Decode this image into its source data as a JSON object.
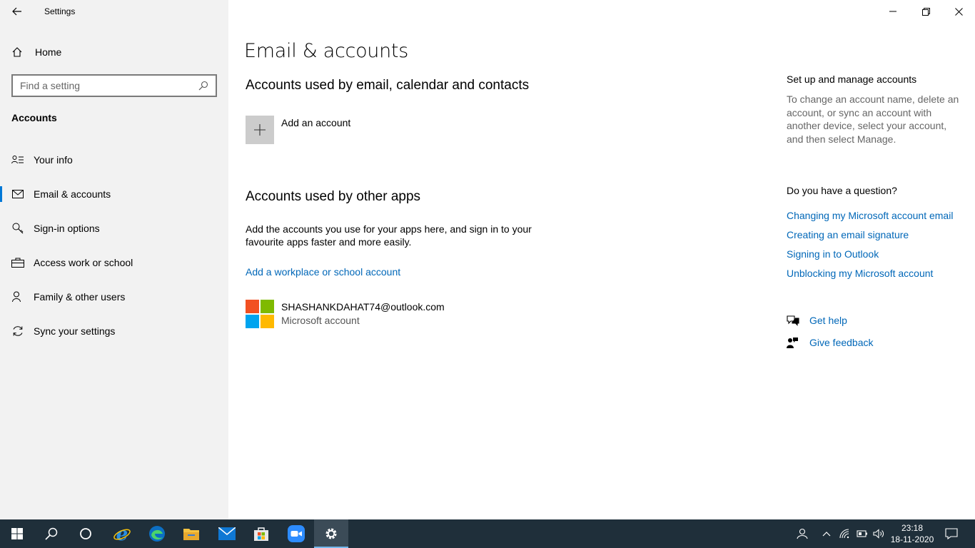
{
  "window": {
    "title": "Settings"
  },
  "sidebar": {
    "home_label": "Home",
    "search_placeholder": "Find a setting",
    "section": "Accounts",
    "items": [
      {
        "label": "Your info",
        "icon": "person-card-icon"
      },
      {
        "label": "Email & accounts",
        "icon": "mail-icon",
        "active": true
      },
      {
        "label": "Sign-in options",
        "icon": "key-icon"
      },
      {
        "label": "Access work or school",
        "icon": "briefcase-icon"
      },
      {
        "label": "Family & other users",
        "icon": "person-add-icon"
      },
      {
        "label": "Sync your settings",
        "icon": "sync-icon"
      }
    ]
  },
  "main": {
    "title": "Email & accounts",
    "section1": {
      "heading": "Accounts used by email, calendar and contacts",
      "add_account": "Add an account"
    },
    "section2": {
      "heading": "Accounts used by other apps",
      "description": "Add the accounts you use for your apps here, and sign in to your favourite apps faster and more easily.",
      "add_workplace": "Add a workplace or school account",
      "account": {
        "email": "SHASHANKDAHAT74@outlook.com",
        "type": "Microsoft account"
      }
    }
  },
  "right": {
    "manage_heading": "Set up and manage accounts",
    "manage_text": "To change an account name, delete an account, or sync an account with another device, select your account, and then select Manage.",
    "question_heading": "Do you have a question?",
    "links": [
      "Changing my Microsoft account email",
      "Creating an email signature",
      "Signing in to Outlook",
      "Unblocking my Microsoft account"
    ],
    "get_help": "Get help",
    "give_feedback": "Give feedback"
  },
  "taskbar": {
    "time": "23:18",
    "date": "18-11-2020"
  },
  "colors": {
    "accent": "#0078d7",
    "link": "#0067b8",
    "sidebar_bg": "#f2f2f2",
    "taskbar_bg": "#1f2f3a",
    "ms_red": "#f25022",
    "ms_green": "#7fba00",
    "ms_blue": "#00a4ef",
    "ms_yellow": "#ffb900"
  }
}
